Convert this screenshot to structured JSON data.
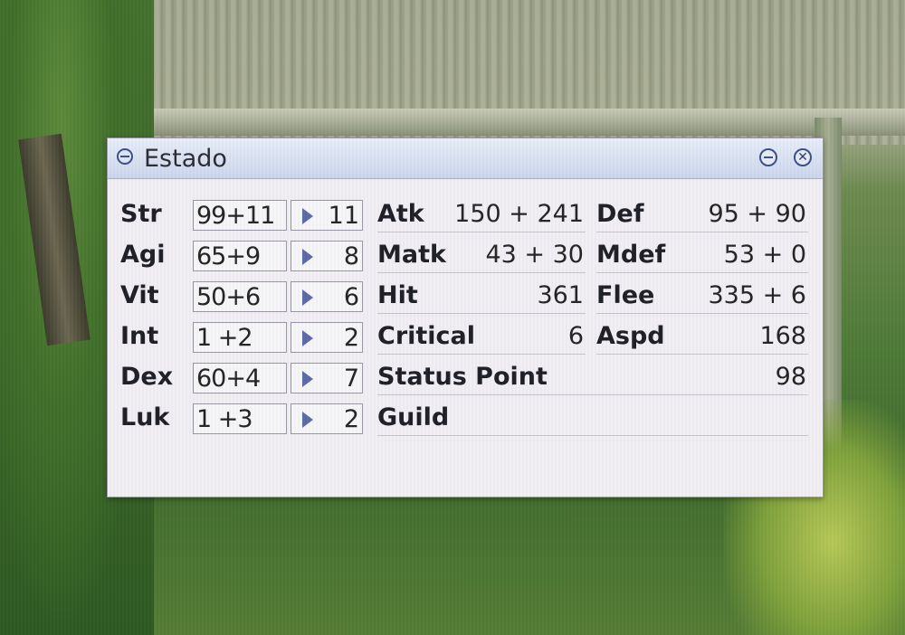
{
  "window": {
    "title": "Estado"
  },
  "stats": [
    {
      "name": "Str",
      "value": "99+11",
      "cost": "11"
    },
    {
      "name": "Agi",
      "value": "65+9",
      "cost": "8"
    },
    {
      "name": "Vit",
      "value": "50+6",
      "cost": "6"
    },
    {
      "name": "Int",
      "value": "1 +2",
      "cost": "2"
    },
    {
      "name": "Dex",
      "value": "60+4",
      "cost": "7"
    },
    {
      "name": "Luk",
      "value": "1 +3",
      "cost": "2"
    }
  ],
  "sub_stats": {
    "atk": {
      "label": "Atk",
      "value": "150 + 241"
    },
    "matk": {
      "label": "Matk",
      "value": "43 + 30"
    },
    "hit": {
      "label": "Hit",
      "value": "361"
    },
    "critical": {
      "label": "Critical",
      "value": "6"
    },
    "def": {
      "label": "Def",
      "value": "95 + 90"
    },
    "mdef": {
      "label": "Mdef",
      "value": "53 + 0"
    },
    "flee": {
      "label": "Flee",
      "value": "335 + 6"
    },
    "aspd": {
      "label": "Aspd",
      "value": "168"
    },
    "status_point": {
      "label": "Status Point",
      "value": "98"
    },
    "guild": {
      "label": "Guild",
      "value": ""
    }
  },
  "icons": {
    "title": "window-menu-icon",
    "minimize": "minimize-icon",
    "close": "close-icon",
    "raise": "raise-stat-arrow-icon"
  },
  "colors": {
    "window_bg": "#f3f1f6",
    "titlebar": "#cdd8ee",
    "accent": "#3a4f86"
  }
}
